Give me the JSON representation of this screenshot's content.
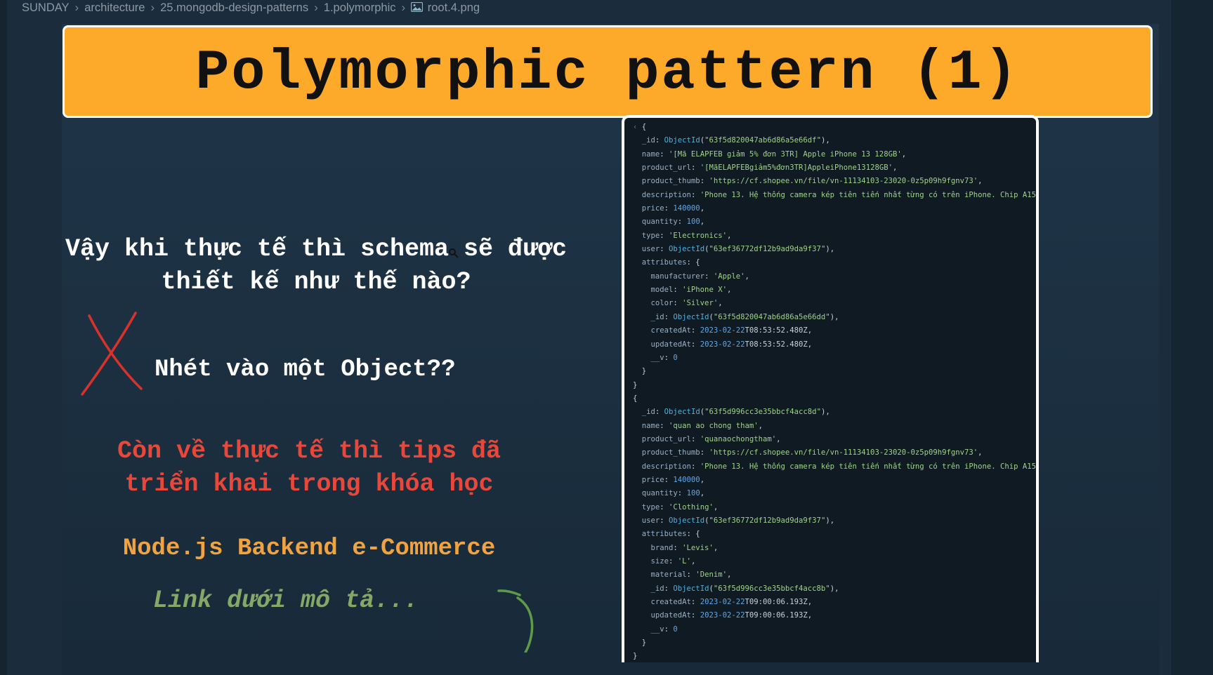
{
  "breadcrumb": {
    "items": [
      "SUNDAY",
      "architecture",
      "25.mongodb-design-patterns",
      "1.polymorphic"
    ],
    "file": "root.4.png",
    "file_icon": "image-icon"
  },
  "slide": {
    "title": "Polymorphic pattern (1)",
    "question_line1": "Vậy khi thực tế thì schema sẽ được",
    "question_line2": "thiết kế như thế nào?",
    "wrong_option": "Nhét vào một Object??",
    "tips_line1": "Còn về thực tế thì tips đã",
    "tips_line2": "triển khai trong khóa học",
    "course": "Node.js Backend e-Commerce",
    "link_hint": "Link dưới mô tả...",
    "accent_colors": {
      "title_bg": "#fda92a",
      "tips": "#e8473a",
      "course": "#f0a340",
      "link": "#84a865",
      "cross": "#d8322a"
    }
  },
  "code": {
    "documents": [
      {
        "_id": "63f5d820047ab6d86a5e66df",
        "name": "'[Mã ELAPFEB giảm 5% đơn 3TR] Apple iPhone 13 128GB'",
        "product_url": "'[MãELAPFEBgiảm5%đơn3TR]AppleiPhone13128GB'",
        "product_thumb": "'https://cf.shopee.vn/file/vn-11134103-23020-0z5p09h9fgnv73'",
        "description": "'Phone 13. Hệ thống camera kép tiên tiến nhất từng có trên iPhone. Chip A15",
        "price": "140000",
        "quantity": "100",
        "type": "'Electronics'",
        "user": "63ef36772df12b9ad9da9f37",
        "attributes": [
          {
            "key": "manufacturer",
            "value": "'Apple'"
          },
          {
            "key": "model",
            "value": "'iPhone X'"
          },
          {
            "key": "color",
            "value": "'Silver'"
          }
        ],
        "attr_id": "63f5d820047ab6d86a5e66dd",
        "createdAt_date": "2023-02-22",
        "createdAt_time": "T08:53:52.480Z",
        "updatedAt_date": "2023-02-22",
        "updatedAt_time": "T08:53:52.480Z",
        "v": "0"
      },
      {
        "_id": "63f5d996cc3e35bbcf4acc8d",
        "name": "'quan ao chong tham'",
        "product_url": "'quanaochongtham'",
        "product_thumb": "'https://cf.shopee.vn/file/vn-11134103-23020-0z5p09h9fgnv73'",
        "description": "'Phone 13. Hệ thống camera kép tiên tiến nhất từng có trên iPhone. Chip A15",
        "price": "140000",
        "quantity": "100",
        "type": "'Clothing'",
        "user": "63ef36772df12b9ad9da9f37",
        "attributes": [
          {
            "key": "brand",
            "value": "'Levis'"
          },
          {
            "key": "size",
            "value": "'L'"
          },
          {
            "key": "material",
            "value": "'Denim'"
          }
        ],
        "attr_id": "63f5d996cc3e35bbcf4acc8b",
        "createdAt_date": "2023-02-22",
        "createdAt_time": "T09:00:06.193Z",
        "updatedAt_date": "2023-02-22",
        "updatedAt_time": "T09:00:06.193Z",
        "v": "0"
      }
    ]
  }
}
